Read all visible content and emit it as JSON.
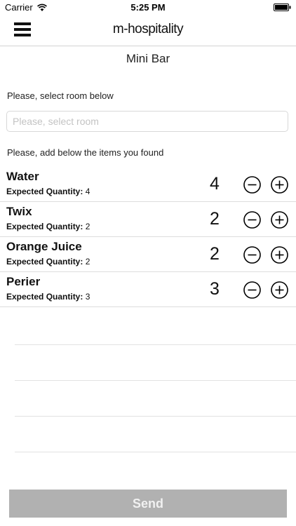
{
  "status_bar": {
    "carrier": "Carrier",
    "time": "5:25 PM"
  },
  "nav": {
    "brand": "m-hospitality",
    "menu_icon": "hamburger-menu-icon"
  },
  "page": {
    "title": "Mini Bar",
    "room_instruction": "Please, select room below",
    "room_placeholder": "Please, select room",
    "room_value": "",
    "items_instruction": "Please, add below the items you found"
  },
  "items": [
    {
      "name": "Water",
      "expected_label": "Expected Quantity:",
      "expected_value": "4",
      "quantity": "4"
    },
    {
      "name": "Twix",
      "expected_label": "Expected Quantity:",
      "expected_value": "2",
      "quantity": "2"
    },
    {
      "name": "Orange Juice",
      "expected_label": "Expected Quantity:",
      "expected_value": "2",
      "quantity": "2"
    },
    {
      "name": "Perier",
      "expected_label": "Expected Quantity:",
      "expected_value": "3",
      "quantity": "3"
    }
  ],
  "icons": {
    "minus": "minus-circle-icon",
    "plus": "plus-circle-icon"
  },
  "send_label": "Send",
  "colors": {
    "send_bg": "#b1b1b1",
    "send_text": "#f1f1f1",
    "separator": "#dddddd"
  }
}
